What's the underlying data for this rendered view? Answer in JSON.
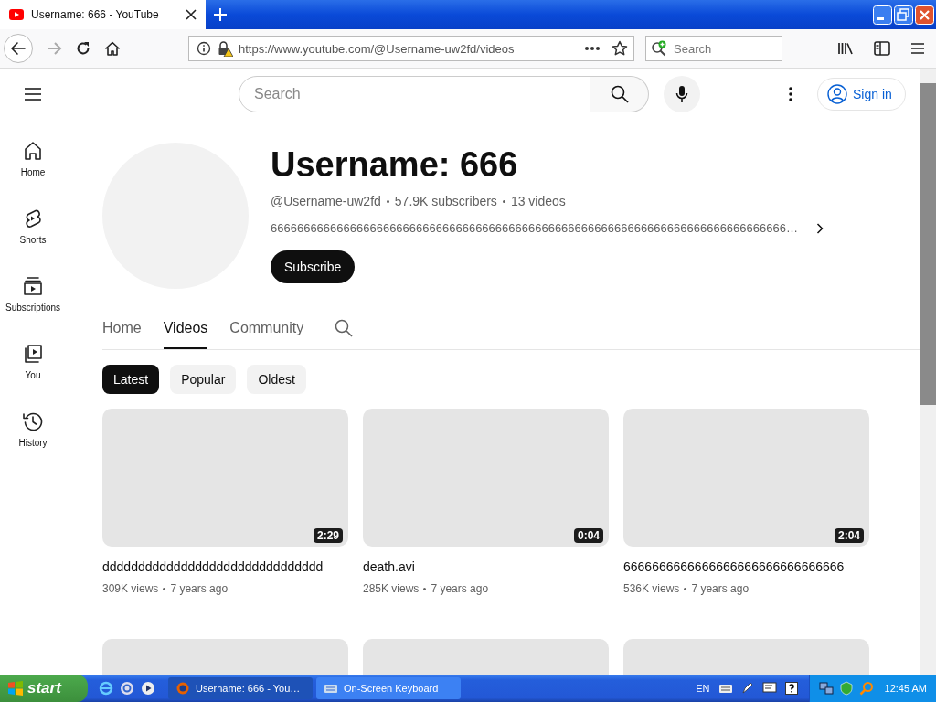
{
  "browser": {
    "tab": {
      "title": "Username: 666 - YouTube"
    },
    "url": "https://www.youtube.com/@Username-uw2fd/videos",
    "search": {
      "placeholder": "Search"
    }
  },
  "youtube": {
    "search": {
      "placeholder": "Search"
    },
    "sign_in": "Sign in",
    "guide": [
      {
        "label": "Home",
        "kind": "home"
      },
      {
        "label": "Shorts",
        "kind": "shorts"
      },
      {
        "label": "Subscriptions",
        "kind": "subscriptions"
      },
      {
        "label": "You",
        "kind": "you"
      },
      {
        "label": "History",
        "kind": "history"
      }
    ],
    "channel": {
      "name": "Username: 666",
      "handle": "@Username-uw2fd",
      "subscribers": "57.9K subscribers",
      "videos": "13 videos",
      "description": "666666666666666666666666666666666666666666666666666666666666666666666666666666…",
      "subscribe": "Subscribe"
    },
    "tabs": [
      {
        "label": "Home",
        "selected": false
      },
      {
        "label": "Videos",
        "selected": true
      },
      {
        "label": "Community",
        "selected": false
      }
    ],
    "chips": [
      {
        "label": "Latest",
        "selected": true
      },
      {
        "label": "Popular",
        "selected": false
      },
      {
        "label": "Oldest",
        "selected": false
      }
    ],
    "videos": [
      {
        "kind": "video",
        "title": "ddddddddddddddddddddddddddddddd",
        "duration": "2:29",
        "views": "309K views",
        "age": "7 years ago"
      },
      {
        "kind": "video",
        "title": "death.avi",
        "duration": "0:04",
        "views": "285K views",
        "age": "7 years ago"
      },
      {
        "kind": "video",
        "title": "6666666666666666666666666666666",
        "duration": "2:04",
        "views": "536K views",
        "age": "7 years ago"
      },
      {
        "kind": "cut"
      },
      {
        "kind": "cut"
      },
      {
        "kind": "cut"
      }
    ]
  },
  "taskbar": {
    "start": "start",
    "tasks": [
      {
        "label": "Username: 666 - You…",
        "kind": "browser",
        "selected": true
      },
      {
        "label": "On-Screen Keyboard",
        "kind": "keyboard",
        "selected": false
      }
    ],
    "language": "EN",
    "clock": "12:45 AM"
  }
}
